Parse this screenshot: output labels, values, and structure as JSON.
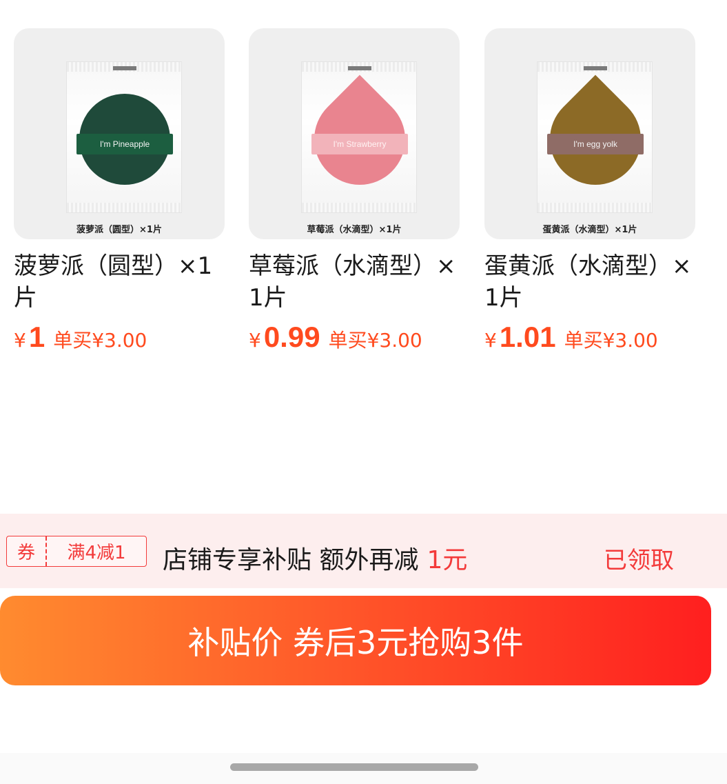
{
  "products": [
    {
      "image_caption": "菠萝派（圆型）×1片",
      "ribbon_text": "I'm Pineapple",
      "title": "菠萝派（圆型）×1片",
      "currency": "¥",
      "price": "1",
      "single_price": "单买¥3.00",
      "colors": {
        "puff": "#1f4a3a",
        "ribbon": "#1c5e40"
      }
    },
    {
      "image_caption": "草莓派（水滴型）×1片",
      "ribbon_text": "I'm Strawberry",
      "title": "草莓派（水滴型）×1片",
      "currency": "¥",
      "price": "0.99",
      "single_price": "单买¥3.00",
      "colors": {
        "puff": "#e9848f",
        "ribbon": "#f2b3ba"
      }
    },
    {
      "image_caption": "蛋黄派（水滴型）×1片",
      "ribbon_text": "I'm egg yolk",
      "title": "蛋黄派（水滴型）×1片",
      "currency": "¥",
      "price": "1.01",
      "single_price": "单买¥3.00",
      "colors": {
        "puff": "#8c6a26",
        "ribbon": "#8f6c66"
      }
    }
  ],
  "coupon": {
    "tag_label": "券",
    "tag_value": "满4减1",
    "text": "店铺专享补贴 额外再减",
    "amount": "1元",
    "status": "已领取"
  },
  "buy_button": {
    "label": "补贴价 券后3元抢购3件"
  },
  "colors": {
    "accent": "#ff4a1e",
    "coupon_red": "#f33a3a",
    "coupon_bg": "#fdeeee",
    "button_gradient_start": "#ff8b2f",
    "button_gradient_end": "#ff1f1f"
  }
}
